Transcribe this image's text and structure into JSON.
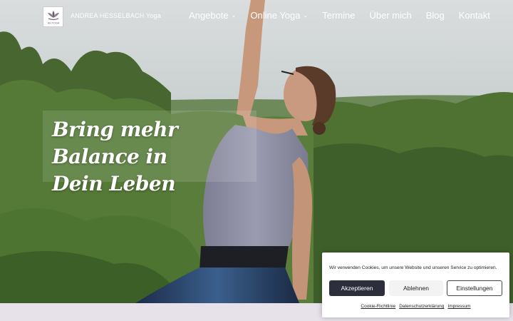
{
  "header": {
    "site_name": "ANDREA HESSELBACH Yoga",
    "logo_label": "AH YOGA"
  },
  "nav": {
    "items": [
      {
        "label": "Angebote",
        "has_dropdown": true
      },
      {
        "label": "Online Yoga",
        "has_dropdown": true
      },
      {
        "label": "Termine",
        "has_dropdown": false
      },
      {
        "label": "Über mich",
        "has_dropdown": false
      },
      {
        "label": "Blog",
        "has_dropdown": false
      },
      {
        "label": "Kontakt",
        "has_dropdown": false
      }
    ],
    "chevron": "⌄"
  },
  "hero": {
    "headline_line1": "Bring mehr Balance in",
    "headline_line2": "Dein Leben"
  },
  "cookie": {
    "text": "Wir verwenden Cookies, um unsere Website und unseren Service zu optimieren.",
    "accept_label": "Akzeptieren",
    "reject_label": "Ablehnen",
    "settings_label": "Einstellungen",
    "links": {
      "policy": "Cookie-Richtlinie",
      "privacy": "Datenschutzerklärung",
      "imprint": "Impressum"
    }
  },
  "colors": {
    "accept_bg": "#2c2e3b",
    "footer_strip": "#e7e1ea"
  },
  "icons": {
    "logo": "lotus-logo-icon",
    "dropdown": "chevron-down-icon"
  }
}
